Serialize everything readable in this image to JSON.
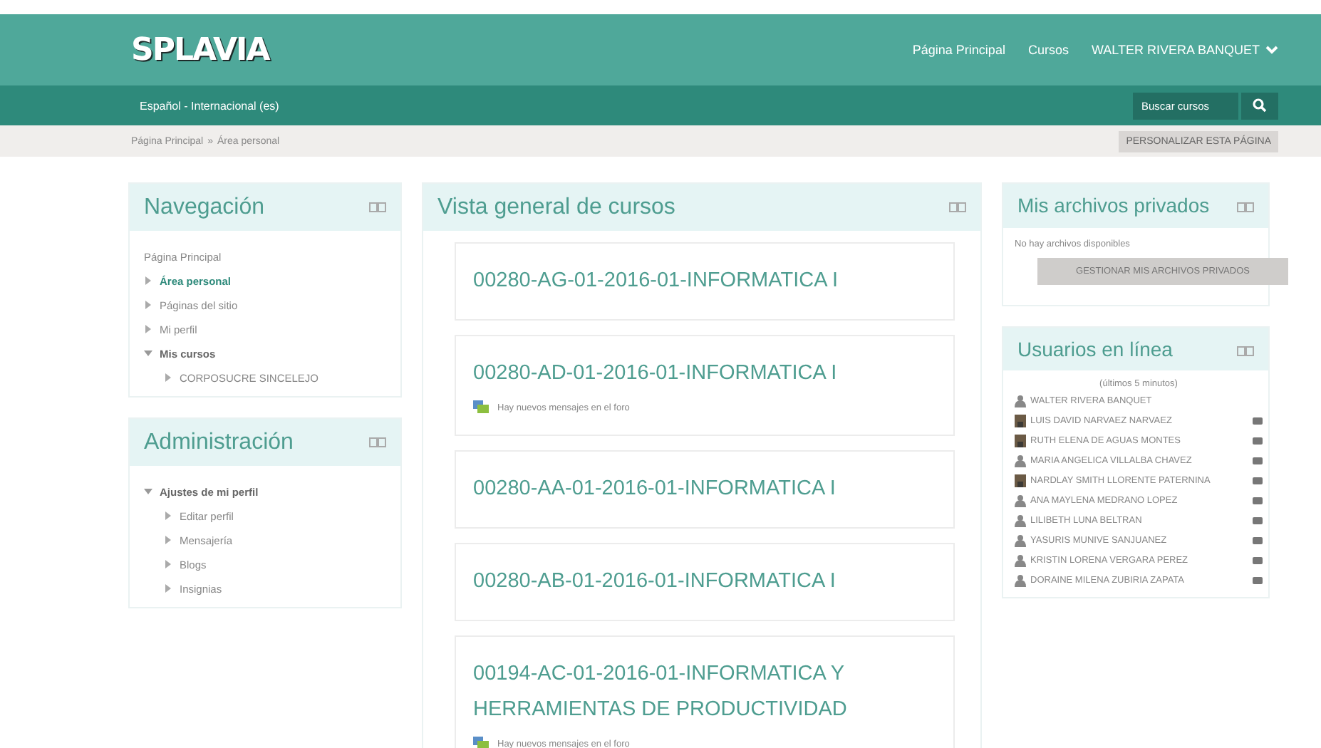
{
  "header": {
    "logo": "SPLAVIA",
    "links": [
      "Página Principal",
      "Cursos"
    ],
    "user": "WALTER RIVERA BANQUET"
  },
  "subbar": {
    "language": "Español - Internacional (es)",
    "search": {
      "placeholder": "Buscar cursos"
    }
  },
  "breadcrumb": {
    "items": [
      "Página Principal",
      "Área personal"
    ],
    "separator": "»",
    "button": "PERSONALIZAR ESTA PÁGINA"
  },
  "navigation": {
    "title": "Navegación",
    "items": [
      {
        "label": "Página Principal",
        "kind": "plain",
        "current": false
      },
      {
        "label": "Área personal",
        "kind": "node",
        "current": true,
        "expanded": false
      },
      {
        "label": "Páginas del sitio",
        "kind": "node",
        "current": false,
        "expanded": false
      },
      {
        "label": "Mi perfil",
        "kind": "node",
        "current": false,
        "expanded": false
      },
      {
        "label": "Mis cursos",
        "kind": "node",
        "current": false,
        "expanded": true,
        "children": [
          {
            "label": "CORPOSUCRE SINCELEJO",
            "kind": "node",
            "current": false,
            "expanded": false
          }
        ]
      }
    ]
  },
  "administration": {
    "title": "Administración",
    "items": [
      {
        "label": "Ajustes de mi perfil",
        "kind": "node",
        "current": false,
        "expanded": true,
        "children": [
          {
            "label": "Editar perfil",
            "kind": "node",
            "current": false,
            "expanded": false
          },
          {
            "label": "Mensajería",
            "kind": "node",
            "current": false,
            "expanded": false
          },
          {
            "label": "Blogs",
            "kind": "node",
            "current": false,
            "expanded": false
          },
          {
            "label": "Insignias",
            "kind": "node",
            "current": false,
            "expanded": false
          }
        ]
      }
    ]
  },
  "courses": {
    "title": "Vista general de cursos",
    "items": [
      {
        "title": "00280-AG-01-2016-01-INFORMATICA I"
      },
      {
        "title": "00280-AD-01-2016-01-INFORMATICA I",
        "notice": "Hay nuevos mensajes en el foro"
      },
      {
        "title": "00280-AA-01-2016-01-INFORMATICA I"
      },
      {
        "title": "00280-AB-01-2016-01-INFORMATICA I"
      },
      {
        "title": "00194-AC-01-2016-01-INFORMATICA Y HERRAMIENTAS DE PRODUCTIVIDAD",
        "notice": "Hay nuevos mensajes en el foro"
      }
    ]
  },
  "private_files": {
    "title": "Mis archivos privados",
    "empty": "No hay archivos disponibles",
    "button": "GESTIONAR MIS ARCHIVOS PRIVADOS"
  },
  "online_users": {
    "title": "Usuarios en línea",
    "period": "(últimos 5 minutos)",
    "users": [
      {
        "name": "WALTER RIVERA BANQUET",
        "kind": "generic",
        "message": false
      },
      {
        "name": "LUIS DAVID NARVAEZ NARVAEZ",
        "kind": "photo",
        "message": true
      },
      {
        "name": "RUTH ELENA DE AGUAS MONTES",
        "kind": "photo",
        "message": true
      },
      {
        "name": "MARIA ANGELICA VILLALBA CHAVEZ",
        "kind": "generic",
        "message": true
      },
      {
        "name": "NARDLAY SMITH LLORENTE PATERNINA",
        "kind": "photo",
        "message": true
      },
      {
        "name": "ANA MAYLENA MEDRANO LOPEZ",
        "kind": "generic",
        "message": true
      },
      {
        "name": "LILIBETH LUNA BELTRAN",
        "kind": "generic",
        "message": true
      },
      {
        "name": "YASURIS MUNIVE SANJUANEZ",
        "kind": "generic",
        "message": true
      },
      {
        "name": "KRISTIN LORENA VERGARA PEREZ",
        "kind": "generic",
        "message": true
      },
      {
        "name": "DORAINE MILENA ZUBIRIA ZAPATA",
        "kind": "generic",
        "message": true
      }
    ]
  }
}
